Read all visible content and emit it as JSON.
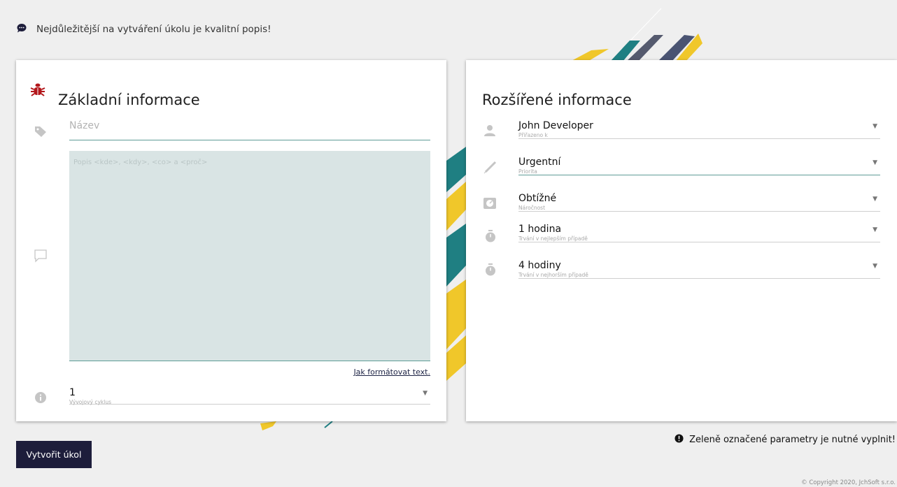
{
  "tip": {
    "text": "Nejdůležitější na vytváření úkolu je kvalitní popis!",
    "icon": "chat-bubble-icon"
  },
  "basic": {
    "title": "Základní informace",
    "title_icon": "bug-icon",
    "name_placeholder": "Název",
    "description_placeholder": "Popis <kde>, <kdy>, <co> a <proč>",
    "format_link": "Jak formátovat text.",
    "cycle": {
      "value": "1",
      "label": "Vývojový cyklus"
    }
  },
  "extended": {
    "title": "Rozšířené informace",
    "fields": [
      {
        "value": "John Developer",
        "label": "Přiřazeno k",
        "icon": "user-icon"
      },
      {
        "value": "Urgentní",
        "label": "Priorita",
        "icon": "syringe-icon"
      },
      {
        "value": "Obtížné",
        "label": "Náročnost",
        "icon": "gauge-icon"
      },
      {
        "value": "1 hodina",
        "label": "Trvání v nejlepším případě",
        "icon": "stopwatch-icon"
      },
      {
        "value": "4 hodiny",
        "label": "Trvání v nejhorším případě",
        "icon": "stopwatch-icon"
      }
    ]
  },
  "actions": {
    "create_label": "Vytvořit úkol"
  },
  "footer": {
    "required_note": "Zeleně označené parametry je nutné vyplnit!",
    "copyright": "© Copyright 2020, JchSoft s.r.o."
  },
  "colors": {
    "accent": "#5f9c97",
    "button": "#1d1d3b",
    "bug": "#b3171b",
    "textarea_bg": "#d9e4e4"
  }
}
